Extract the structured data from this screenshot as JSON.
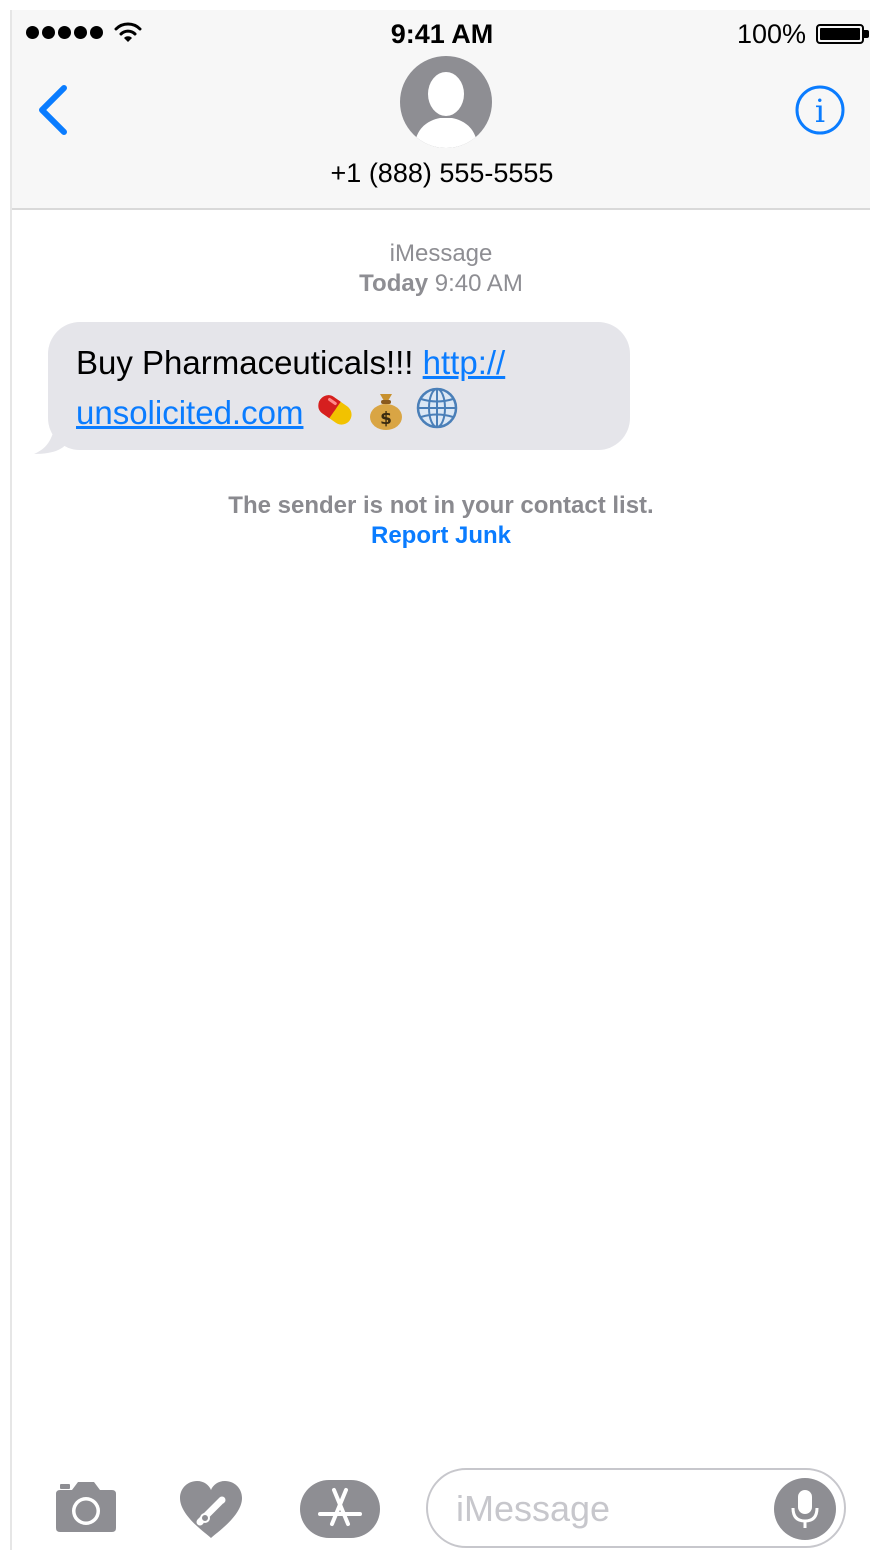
{
  "status_bar": {
    "time": "9:41 AM",
    "battery_percent": "100%"
  },
  "header": {
    "contact_number": "+1 (888) 555-5555"
  },
  "conversation": {
    "service": "iMessage",
    "timestamp_day": "Today",
    "timestamp_time": "9:40 AM",
    "message": {
      "text": "Buy Pharmaceuticals!!! ",
      "link_part1": "http://",
      "link_part2": "unsolicited.com"
    },
    "junk_notice": "The sender is not in your contact list.",
    "report_junk": "Report Junk"
  },
  "input_bar": {
    "placeholder": "iMessage"
  },
  "icons": [
    "signal-dots",
    "wifi-icon",
    "battery-icon",
    "back-chevron-icon",
    "contact-avatar-icon",
    "info-icon",
    "pill-emoji",
    "money-bag-emoji",
    "globe-emoji",
    "camera-icon",
    "digital-touch-icon",
    "app-store-icon",
    "microphone-icon"
  ],
  "colors": {
    "accent": "#0a7cff",
    "bubble_gray": "#e5e5ea",
    "icon_gray": "#8e8e93"
  }
}
